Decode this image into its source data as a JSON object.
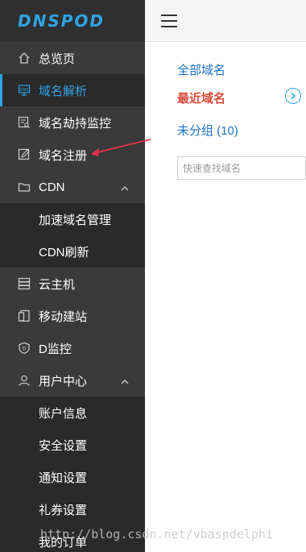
{
  "logo": {
    "text": "DNSPOD"
  },
  "sidebar": {
    "items": [
      {
        "label": "总览页",
        "icon": "home-icon"
      },
      {
        "label": "域名解析",
        "icon": "dns-icon",
        "active": true
      },
      {
        "label": "域名劫持监控",
        "icon": "monitor-search-icon"
      },
      {
        "label": "域名注册",
        "icon": "edit-register-icon"
      },
      {
        "label": "CDN",
        "icon": "folder-icon",
        "expanded": true,
        "children": [
          "加速域名管理",
          "CDN刷新"
        ]
      },
      {
        "label": "云主机",
        "icon": "server-icon"
      },
      {
        "label": "移动建站",
        "icon": "mobile-site-icon"
      },
      {
        "label": "D监控",
        "icon": "shield-icon"
      },
      {
        "label": "用户中心",
        "icon": "user-icon",
        "expanded": true,
        "children": [
          "账户信息",
          "安全设置",
          "通知设置",
          "礼券设置",
          "我的订单"
        ]
      }
    ]
  },
  "main": {
    "all_domains": "全部域名",
    "recent_domains": "最近域名",
    "ungrouped": "未分组 (10)",
    "search_placeholder": "快速查找域名"
  },
  "watermark": "http://blog.csdn.net/vbaspdelphi",
  "colors": {
    "accent": "#2fa4e7",
    "sidebar_bg": "#3a3a3a",
    "link_blue": "#1a73c8",
    "recent_red": "#d84a3a",
    "annotation_arrow": "#e8334a"
  }
}
